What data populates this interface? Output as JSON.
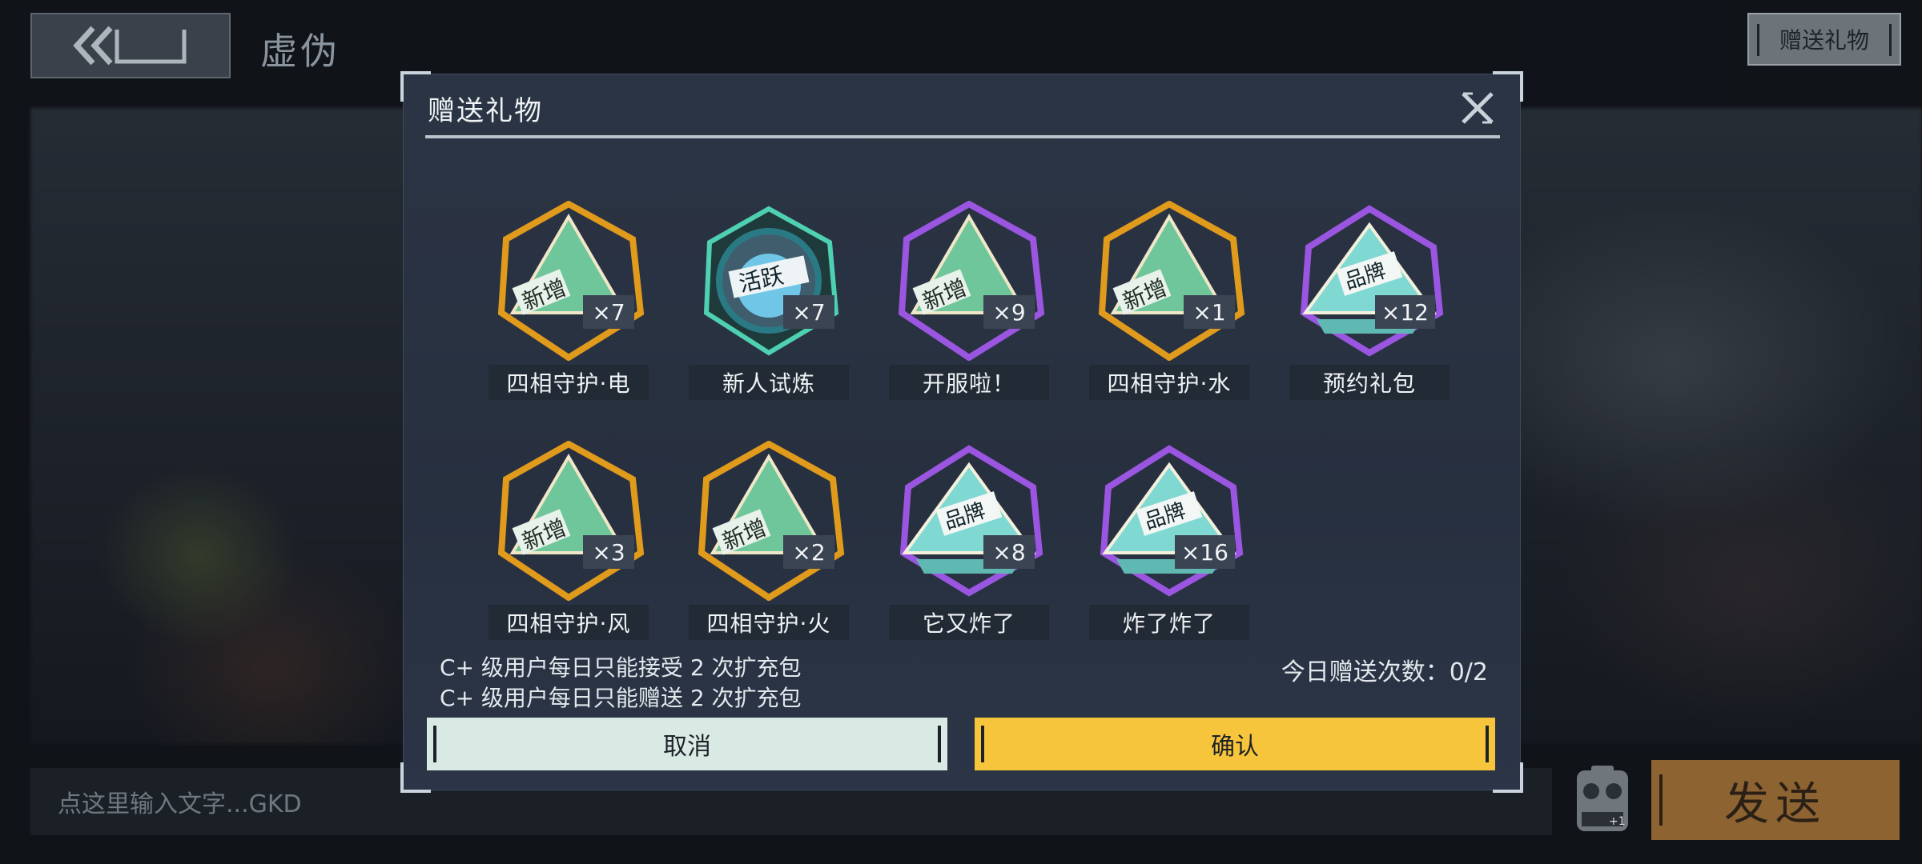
{
  "header": {
    "back_icon": "double-chevron-left-icon",
    "title": "虚伪",
    "gift_button_label": "赠送礼物"
  },
  "footer": {
    "input_placeholder": "点这里输入文字...GKD",
    "controller_icon": "gamepad-icon",
    "send_label": "发送"
  },
  "modal": {
    "title": "赠送礼物",
    "close_icon": "close-icon",
    "gifts": [
      {
        "name": "四相守护·电",
        "count": "×7",
        "badge": "新增",
        "style": "gold-green"
      },
      {
        "name": "新人试炼",
        "count": "×7",
        "badge": "活跃",
        "style": "teal-circle"
      },
      {
        "name": "开服啦！",
        "count": "×9",
        "badge": "新增",
        "style": "purple-green"
      },
      {
        "name": "四相守护·水",
        "count": "×1",
        "badge": "新增",
        "style": "gold-green"
      },
      {
        "name": "预约礼包",
        "count": "×12",
        "badge": "品牌",
        "style": "purple-cyan"
      },
      {
        "name": "四相守护·风",
        "count": "×3",
        "badge": "新增",
        "style": "gold-green"
      },
      {
        "name": "四相守护·火",
        "count": "×2",
        "badge": "新增",
        "style": "gold-green"
      },
      {
        "name": "它又炸了",
        "count": "×8",
        "badge": "品牌",
        "style": "purple-cyan"
      },
      {
        "name": "炸了炸了",
        "count": "×16",
        "badge": "品牌",
        "style": "purple-cyan"
      }
    ],
    "note_receive": "C+ 级用户每日只能接受 2 次扩充包",
    "note_send": "C+ 级用户每日只能赠送 2 次扩充包",
    "daily_count": "今日赠送次数：0/2",
    "cancel_label": "取消",
    "confirm_label": "确认"
  },
  "colors": {
    "confirm": "#f7c53c",
    "cancel": "#d9e9e4",
    "send": "#8d6332",
    "modal_bg": "#2b3444"
  }
}
